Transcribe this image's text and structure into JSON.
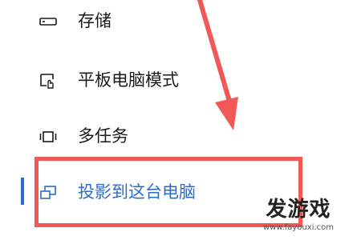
{
  "sidebar": {
    "items": [
      {
        "label": "存储",
        "icon": "storage-icon"
      },
      {
        "label": "平板电脑模式",
        "icon": "tablet-mode-icon"
      },
      {
        "label": "多任务",
        "icon": "multitasking-icon"
      },
      {
        "label": "投影到这台电脑",
        "icon": "project-to-pc-icon",
        "selected": true
      }
    ]
  },
  "annotation": {
    "arrow_color": "#f25858",
    "box_color": "#f25858"
  },
  "accent_color": "#2b6ccf",
  "watermark": {
    "logo": "发游戏",
    "url": "www.fayouxi.com"
  }
}
